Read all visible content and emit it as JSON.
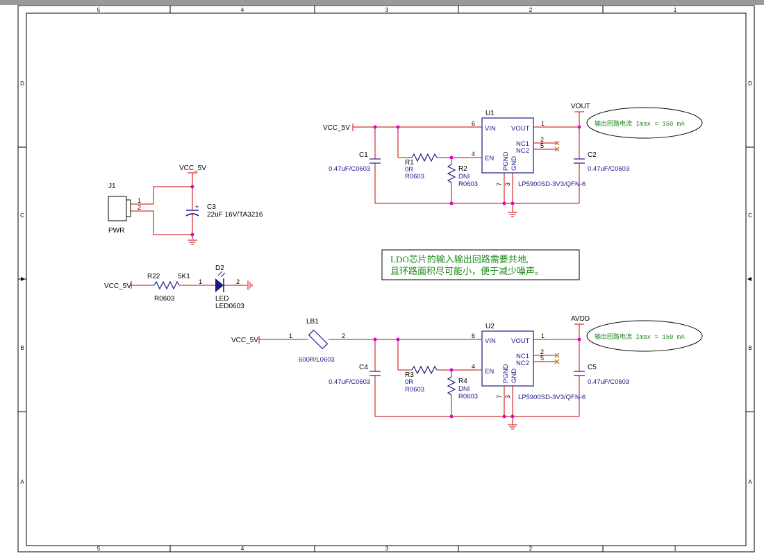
{
  "sheet": {
    "columns": [
      "5",
      "4",
      "3",
      "2",
      "1"
    ],
    "rows": [
      "D",
      "C",
      "B",
      "A"
    ]
  },
  "nets": {
    "vcc_5v": "VCC_5V",
    "vout": "VOUT",
    "avdd": "AVDD"
  },
  "power_block": {
    "j1_ref": "J1",
    "j1_value": "PWR",
    "j1_pin1": "1",
    "j1_pin2": "2",
    "c3_ref": "C3",
    "c3_value": "22uF 16V/TA3216",
    "c3_plus": "+"
  },
  "led_block": {
    "r22_ref": "R22",
    "r22_value": "5K1",
    "r22_footprint": "R0603",
    "d2_ref": "D2",
    "d2_value": "LED",
    "d2_footprint": "LED0603",
    "pin1": "1",
    "pin2": "2"
  },
  "ldo1": {
    "u_ref": "U1",
    "part": "LP5900SD-3V3/QFN-6",
    "c_in_ref": "C1",
    "c_in_value": "0.47uF/C0603",
    "c_out_ref": "C2",
    "c_out_value": "0.47uF/C0603",
    "r_en_ref": "R1",
    "r_en_value": "0R",
    "r_en_footprint": "R0603",
    "r_pd_ref": "R2",
    "r_pd_value": "DNI",
    "r_pd_footprint": "R0603"
  },
  "ldo2": {
    "u_ref": "U2",
    "part": "LP5900SD-3V3/QFN-6",
    "c_in_ref": "C4",
    "c_in_value": "0.47uF/C0603",
    "c_out_ref": "C5",
    "c_out_value": "0.47uF/C0603",
    "r_en_ref": "R3",
    "r_en_value": "0R",
    "r_en_footprint": "R0603",
    "r_pd_ref": "R4",
    "r_pd_value": "DNI",
    "r_pd_footprint": "R0603",
    "lb_ref": "LB1",
    "lb_value": "600R/L0603",
    "lb_pin1": "1",
    "lb_pin2": "2"
  },
  "ldo_pins": {
    "vin": "VIN",
    "vout": "VOUT",
    "en": "EN",
    "nc1": "NC1",
    "nc2": "NC2",
    "pgnd": "PGND",
    "gnd": "GND",
    "p1": "1",
    "p2": "2",
    "p3": "3",
    "p4": "4",
    "p5": "5",
    "p6": "6",
    "p7": "7"
  },
  "notes": {
    "current_limit": "输出回路电流 Imax = 150 mA",
    "layout_line1": "LDO芯片的输入输出回路需要共地,",
    "layout_line2": "且环路面积尽可能小，便于减少噪声。"
  }
}
